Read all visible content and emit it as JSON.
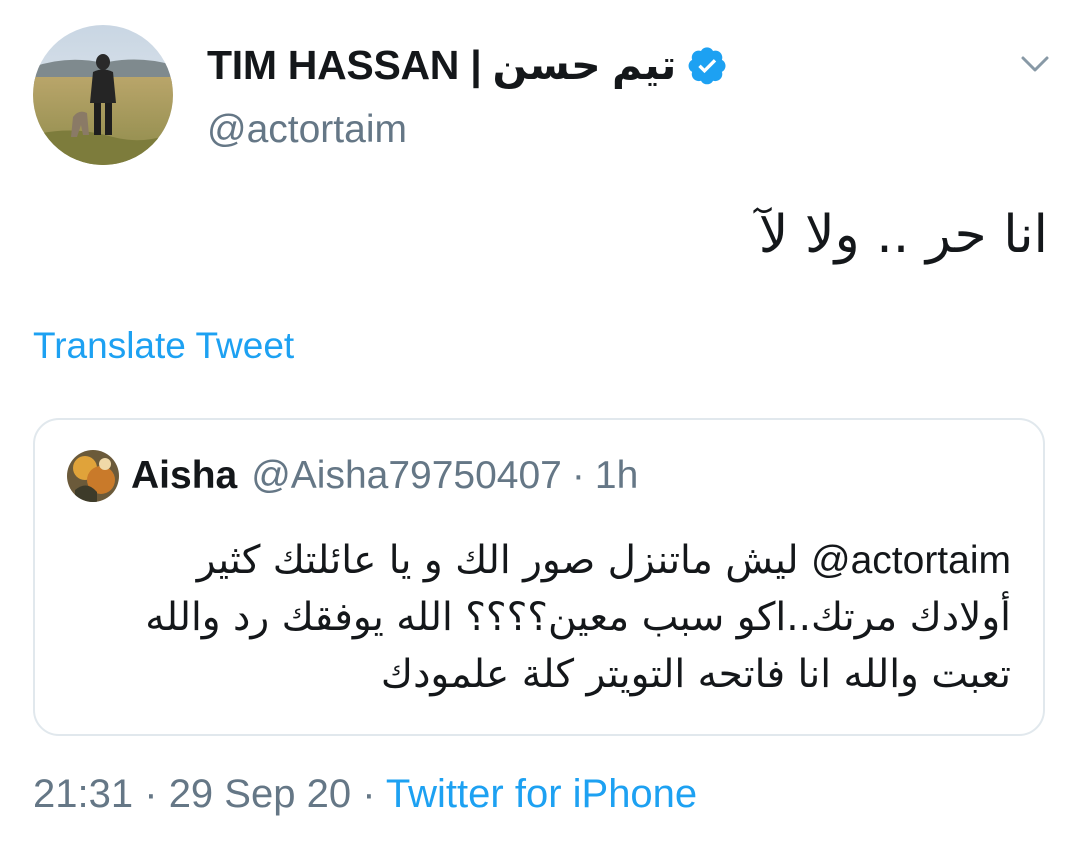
{
  "tweet": {
    "author": {
      "display_name": "TIM HASSAN | تيم حسن",
      "handle": "@actortaim",
      "verified": true,
      "avatar_icon": "profile-photo-person-with-dog"
    },
    "text": "انا حر .. ولا لآ",
    "translate_label": "Translate Tweet",
    "menu_icon": "chevron-down-icon",
    "quoted": {
      "name": "Aisha",
      "handle": "@Aisha79750407",
      "separator": "·",
      "time": "1h",
      "mention": "@actortaim",
      "text": "ليش ماتنزل صور الك و يا عائلتك كثير أولادك مرتك..اكو سبب معين؟؟؟؟ الله يوفقك رد والله تعبت والله انا فاتحه التويتر كلة علمودك"
    },
    "meta": {
      "time": "21:31",
      "separator": "·",
      "date": "29 Sep 20",
      "source": "Twitter for iPhone"
    }
  },
  "colors": {
    "text_primary": "#14171a",
    "text_secondary": "#657786",
    "accent": "#1da1f2",
    "border": "#e1e8ed"
  }
}
